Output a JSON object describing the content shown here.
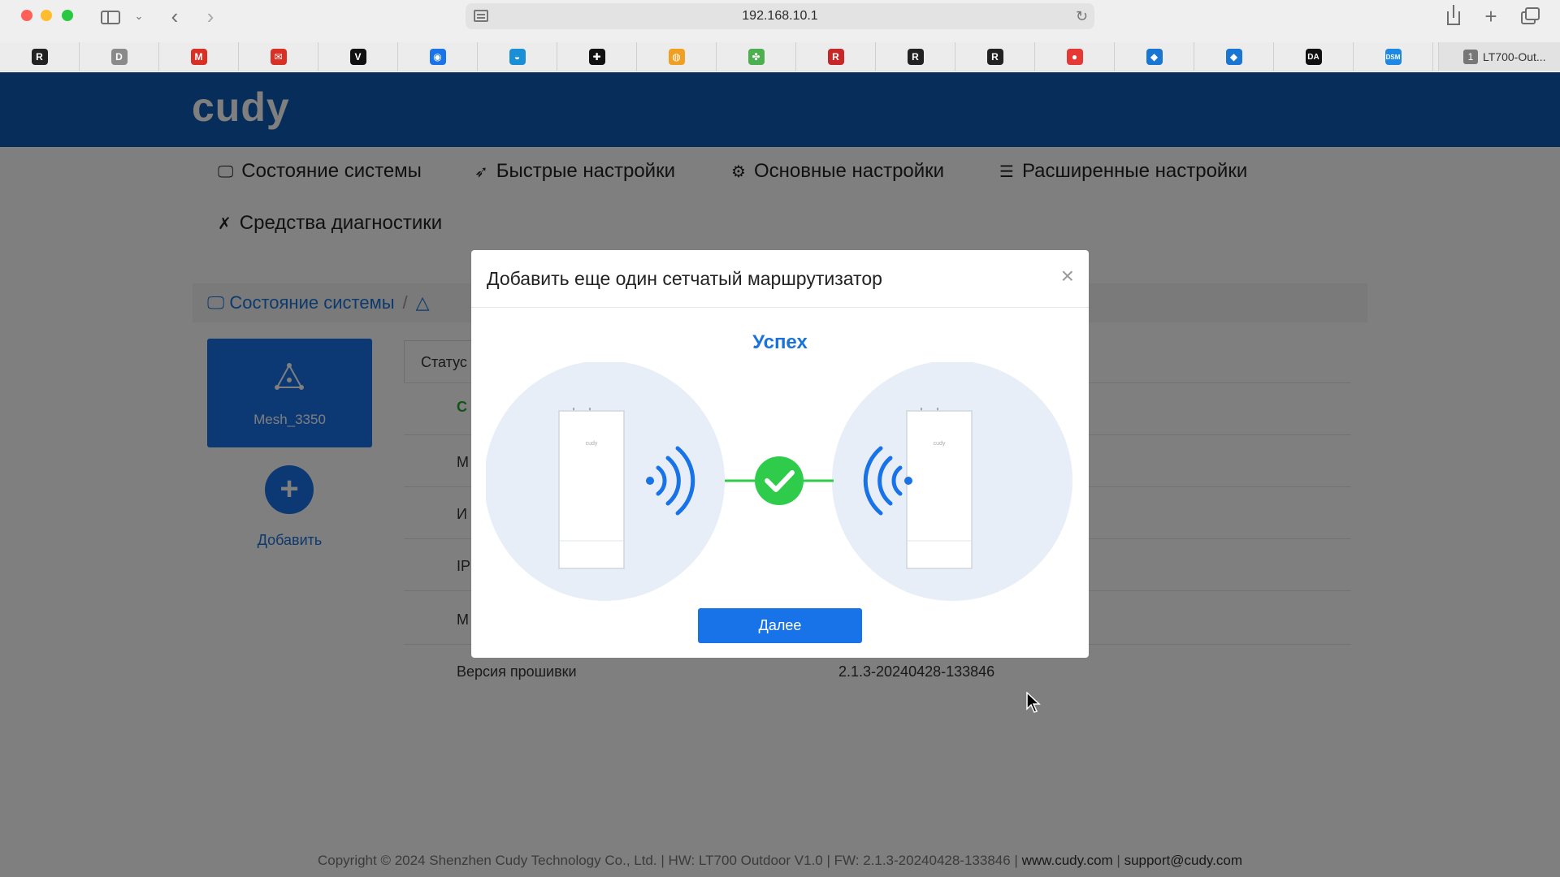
{
  "browser": {
    "url": "192.168.10.1",
    "active_tab_count": "1",
    "active_tab_title": "LT700-Out...",
    "favorites": [
      {
        "icon": "r-icon",
        "glyph": "R",
        "color": "#222222"
      },
      {
        "icon": "d-icon",
        "glyph": "D",
        "color": "#8a8a8a"
      },
      {
        "icon": "gmail-icon",
        "glyph": "M",
        "color": "#d93025"
      },
      {
        "icon": "mail-icon",
        "glyph": "✉",
        "color": "#d93025"
      },
      {
        "icon": "v-icon",
        "glyph": "V",
        "color": "#111111"
      },
      {
        "icon": "chat-icon",
        "glyph": "◉",
        "color": "#1a73e8"
      },
      {
        "icon": "cloud-icon",
        "glyph": "◒",
        "color": "#1a8fd6"
      },
      {
        "icon": "plus-circle-icon",
        "glyph": "✚",
        "color": "#111111"
      },
      {
        "icon": "globe-icon",
        "glyph": "◍",
        "color": "#f0a020"
      },
      {
        "icon": "pinwheel-icon",
        "glyph": "✤",
        "color": "#4caf50"
      },
      {
        "icon": "r-red-icon",
        "glyph": "R",
        "color": "#c62828"
      },
      {
        "icon": "r-icon",
        "glyph": "R",
        "color": "#222222"
      },
      {
        "icon": "r-icon",
        "glyph": "R",
        "color": "#222222"
      },
      {
        "icon": "red-dot-icon",
        "glyph": "●",
        "color": "#e53935"
      },
      {
        "icon": "bird-icon",
        "glyph": "◆",
        "color": "#1976d2"
      },
      {
        "icon": "bird-icon",
        "glyph": "◆",
        "color": "#1976d2"
      },
      {
        "icon": "da-icon",
        "glyph": "DA",
        "color": "#111111"
      },
      {
        "icon": "dsm-icon",
        "glyph": "DSM",
        "color": "#1e88e5"
      }
    ]
  },
  "app": {
    "logo": "cudy",
    "nav": [
      {
        "label": "Состояние системы",
        "icon": "monitor-icon"
      },
      {
        "label": "Быстрые настройки",
        "icon": "rocket-icon"
      },
      {
        "label": "Основные настройки",
        "icon": "gear-icon"
      },
      {
        "label": "Расширенные настройки",
        "icon": "sliders-icon"
      },
      {
        "label": "Средства диагностики",
        "icon": "tools-icon"
      }
    ],
    "breadcrumb": "Состояние системы",
    "device_name": "Mesh_3350",
    "add_label": "Добавить",
    "status_header": "Статус",
    "status_rows": [
      {
        "label": "С",
        "value": ""
      },
      {
        "label": "М",
        "value": ""
      },
      {
        "label": "И",
        "value": ""
      },
      {
        "label": "IP",
        "value": ""
      },
      {
        "label": "М",
        "value": ""
      },
      {
        "label": "Версия прошивки",
        "value": "2.1.3-20240428-133846"
      }
    ],
    "footer": {
      "copyright": "Copyright © 2024 Shenzhen Cudy Technology Co., Ltd.",
      "hw": "HW: LT700 Outdoor V1.0",
      "fw": "FW: 2.1.3-20240428-133846",
      "site": "www.cudy.com",
      "support": "support@cudy.com"
    }
  },
  "modal": {
    "title": "Добавить еще один сетчатый маршрутизатор",
    "status": "Успех",
    "next_button": "Далее",
    "device_brand": "cudy"
  },
  "colors": {
    "header_blue": "#0f5bb5",
    "accent_blue": "#1973e8",
    "success_green": "#2ecc4a",
    "circle_bg": "#e8eef7"
  }
}
